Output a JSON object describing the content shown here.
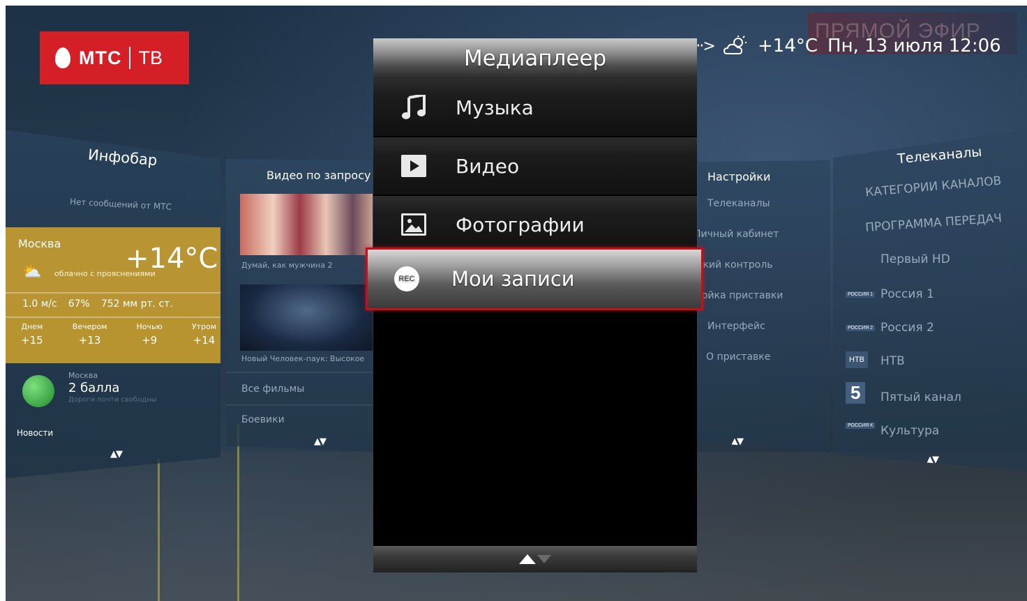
{
  "logo": {
    "brand": "МТС",
    "product": "ТВ"
  },
  "status": {
    "temperature": "+14°C",
    "datetime": "Пн, 13 июля 12:06"
  },
  "background": {
    "live_text": "ПРЯМОЙ ЭФИР"
  },
  "mediaplayer": {
    "title": "Медиаплеер",
    "items": [
      {
        "label": "Музыка",
        "icon": "music-note-icon"
      },
      {
        "label": "Видео",
        "icon": "play-icon"
      },
      {
        "label": "Фотографии",
        "icon": "photo-icon"
      }
    ],
    "selected": {
      "label": "Мои записи",
      "badge": "REC"
    }
  },
  "infobar": {
    "title": "Инфобар",
    "messages": "Нет сообщений от МТС",
    "city": "Москва",
    "temperature": "+14°C",
    "condition": "облачно с прояснениями",
    "wind": "1.0 м/с",
    "humidity": "67%",
    "pressure": "752 мм рт. ст.",
    "forecast": [
      {
        "label": "Днем",
        "temp": "+15"
      },
      {
        "label": "Вечером",
        "temp": "+13"
      },
      {
        "label": "Ночью",
        "temp": "+9"
      },
      {
        "label": "Утром",
        "temp": "+14"
      }
    ],
    "traffic_city": "Москва",
    "traffic_score": "2 балла",
    "traffic_desc": "Дороги почти свободны",
    "news_title": "Новости"
  },
  "vod": {
    "title": "Видео по запросу",
    "thumb1_caption": "Думай, как мужчина 2",
    "thumb2_caption": "Новый Человек-паук: Высокое",
    "all_films": "Все фильмы",
    "action": "Боевики"
  },
  "settings": {
    "title": "Настройки",
    "items": [
      "Телеканалы",
      "Личный кабинет",
      "Родительский контроль",
      "Настройка приставки",
      "Интерфейс",
      "О приставке"
    ]
  },
  "channels": {
    "title": "Телеканалы",
    "items": [
      "КАТЕГОРИИ КАНАЛОВ",
      "ПРОГРАММА ПЕРЕДАЧ",
      "Первый HD",
      "Россия 1",
      "Россия 2",
      "НТВ",
      "Пятый канал",
      "Культура"
    ],
    "badges": {
      "russia1": "РОССИЯ 1",
      "russia2": "РОССИЯ 2",
      "ntv": "НТВ",
      "five": "5",
      "culture": "РОССИЯ К"
    }
  },
  "colors": {
    "brand_red": "#d51f26",
    "selection_border": "#c2101b",
    "weather_amber": "#cda02d"
  }
}
